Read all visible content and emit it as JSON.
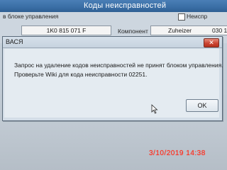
{
  "window": {
    "title": "Коды неисправностей"
  },
  "top_panel": {
    "block_label": "в блоке управления",
    "fault_checkbox_label": "Неиспр",
    "part_number": "1K0 815 071 F",
    "component_label": "Компонент",
    "component_value": "Zuheizer",
    "component_extra": "030 1"
  },
  "dialog": {
    "title": "ВАСЯ",
    "close_symbol": "✕",
    "message_line1": "Запрос на удаление кодов неисправностей не принят блоком управления.",
    "message_line2": "Проверьте Wiki для кода неисправности 02251.",
    "ok_label": "OK"
  },
  "camera": {
    "datestamp": "3/10/2019  14:38",
    "datestamp_color": "#ff2a1a"
  }
}
